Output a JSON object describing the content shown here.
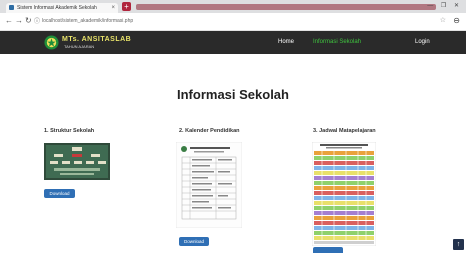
{
  "browser": {
    "tab_title": "Sistem Informasi Akademik Sekolah",
    "tab_close": "×",
    "new_tab": "+",
    "url": "localhost/sistem_akademik/informasi.php",
    "window_controls": "— ❐ ✕"
  },
  "site": {
    "brand": "MTs. ANSITASLAB",
    "brand_sub": "TAHUN AJARAN",
    "nav": {
      "home": "Home",
      "info": "Informasi Sekolah",
      "login": "Login"
    }
  },
  "page": {
    "title": "Informasi Sekolah"
  },
  "sections": [
    {
      "title": "1. Struktur Sekolah",
      "button": "Download"
    },
    {
      "title": "2. Kalender Pendidikan",
      "button": "Download"
    },
    {
      "title": "3. Jadwal Matapelajaran",
      "button": "Download"
    }
  ],
  "back_to_top": "↑",
  "colors": {
    "navbar_bg": "#2a2a2a",
    "active_menu": "#3fc23f",
    "button_bg": "#2f6fb5"
  }
}
